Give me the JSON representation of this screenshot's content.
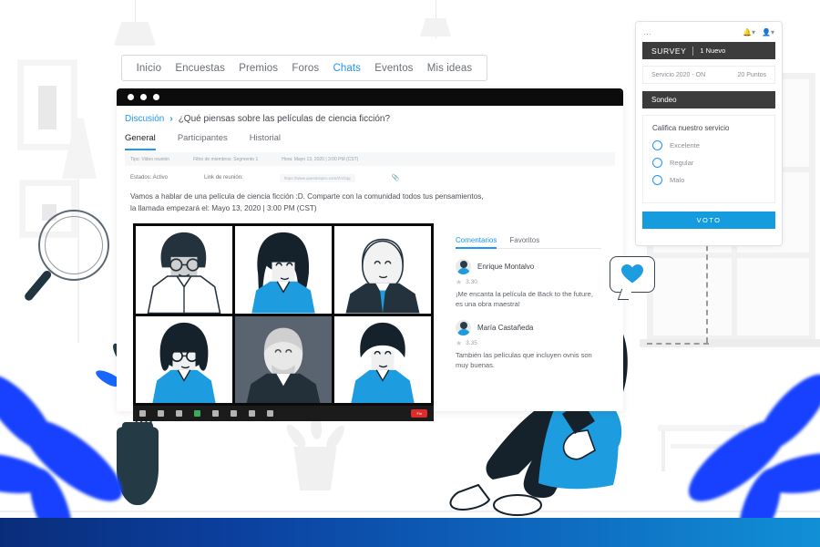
{
  "nav": {
    "items": [
      {
        "label": "Inicio",
        "active": false
      },
      {
        "label": "Encuestas",
        "active": false
      },
      {
        "label": "Premios",
        "active": false
      },
      {
        "label": "Foros",
        "active": false
      },
      {
        "label": "Chats",
        "active": true
      },
      {
        "label": "Eventos",
        "active": false
      },
      {
        "label": "Mis ideas",
        "active": false
      }
    ]
  },
  "browser": {
    "breadcrumb": {
      "link": "Discusión",
      "separator": "›",
      "title": "¿Qué piensas sobre las películas de ciencia ficción?"
    },
    "subtabs": [
      {
        "label": "General",
        "active": true
      },
      {
        "label": "Participantes",
        "active": false
      },
      {
        "label": "Historial",
        "active": false
      }
    ],
    "meta": [
      "Tipo: Video reunión",
      "Filtro de miembros: Segmento 1",
      "Hora: Mayo 13, 2020 | 3:00 PM (CST)"
    ],
    "status_label": "Estados: Activo",
    "link_label": "Link de reunión:",
    "link_url": "https://www.questionpro.com/t/AOqq",
    "clip_icon": "paperclip-icon",
    "body_text": "Vamos a hablar de una película de ciencia ficción :D. Comparte con la comunidad todos tus pensamientos, la llamada empezará el: Mayo 13, 2020 | 3:00 PM (CST)",
    "toolbar": {
      "icons": [
        "microphone-icon",
        "participants-icon",
        "chat-icon",
        "share-screen-icon",
        "view-grid-icon",
        "record-icon",
        "reactions-icon",
        "more-icon"
      ],
      "end_label": "Fin"
    }
  },
  "comments": {
    "tabs": [
      {
        "label": "Comentarios",
        "active": true
      },
      {
        "label": "Favoritos",
        "active": false
      }
    ],
    "items": [
      {
        "author": "Enrique Montalvo",
        "rating": "3.30",
        "text": "¡Me encanta la película de Back to the future, es una obra maestra!"
      },
      {
        "author": "María Castañeda",
        "rating": "3.35",
        "text": "También las películas que incluyen ovnis son muy buenas."
      }
    ]
  },
  "reaction": {
    "icon": "heart-icon"
  },
  "survey": {
    "menu_icon": "more-dots-icon",
    "bell_icon": "bell-icon",
    "user_icon": "user-icon",
    "title": "SURVEY",
    "new_badge": "1 Nuevo",
    "service_name": "Servicio 2020 - ON",
    "points": "20 Puntos",
    "section_label": "Sondeo",
    "question": "Califica nuestro servicio",
    "options": [
      "Excelente",
      "Regular",
      "Malo"
    ],
    "vote_label": "VOTO"
  },
  "colors": {
    "accent_blue": "#159cdf",
    "nav_active": "#2196f3",
    "leaf_blue": "#1741ff",
    "dark_navy": "#203540",
    "footer_from": "#0a2d7a",
    "footer_to": "#1190d6"
  }
}
